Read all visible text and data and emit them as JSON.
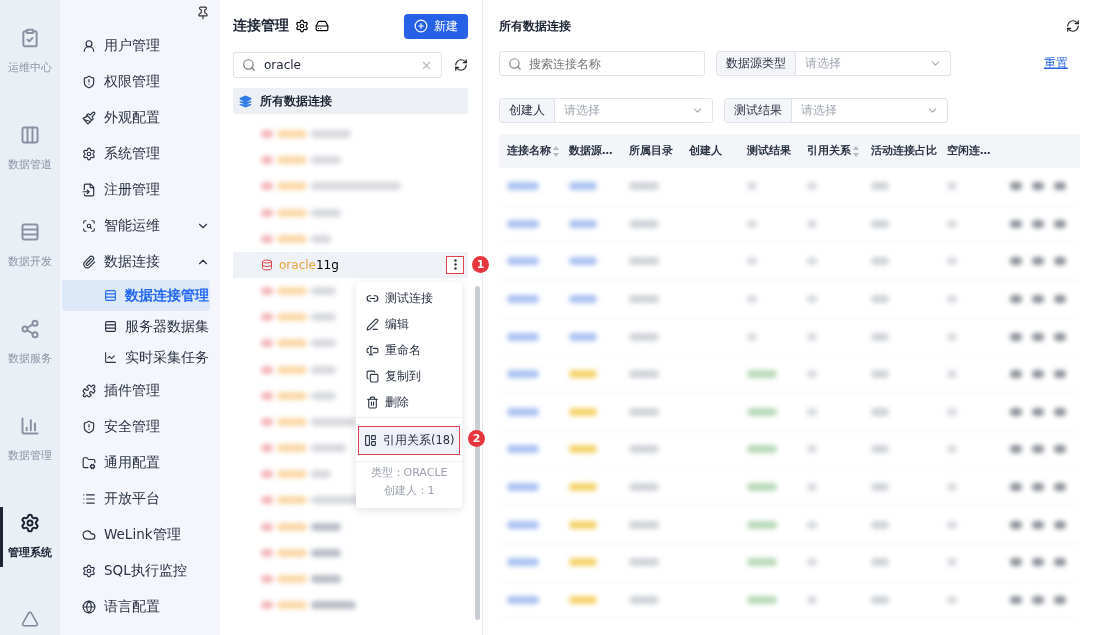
{
  "rail": {
    "items": [
      {
        "label": "运维中心",
        "selected": false
      },
      {
        "label": "数据管道",
        "selected": false
      },
      {
        "label": "数据开发",
        "selected": false
      },
      {
        "label": "数据服务",
        "selected": false
      },
      {
        "label": "数据管理",
        "selected": false
      },
      {
        "label": "管理系统",
        "selected": true
      }
    ]
  },
  "nav": {
    "items": [
      {
        "label": "用户管理"
      },
      {
        "label": "权限管理"
      },
      {
        "label": "外观配置"
      },
      {
        "label": "系统管理"
      },
      {
        "label": "注册管理"
      },
      {
        "label": "智能运维",
        "expanded": false
      },
      {
        "label": "数据连接",
        "expanded": true,
        "children": [
          {
            "label": "数据连接管理",
            "selected": true
          },
          {
            "label": "服务器数据集",
            "selected": false
          },
          {
            "label": "实时采集任务",
            "selected": false
          }
        ]
      },
      {
        "label": "插件管理"
      },
      {
        "label": "安全管理"
      },
      {
        "label": "通用配置"
      },
      {
        "label": "开放平台"
      },
      {
        "label": "WeLink管理"
      },
      {
        "label": "SQL执行监控"
      },
      {
        "label": "语言配置"
      }
    ]
  },
  "tree": {
    "title": "连接管理",
    "new_button": "新建",
    "search": {
      "value": "oracle"
    },
    "root": "所有数据连接",
    "active_item": {
      "match": "oracle",
      "rest": "11g",
      "marker": "1"
    },
    "menu": {
      "items": [
        {
          "label": "测试连接",
          "selected": false
        },
        {
          "label": "编辑",
          "selected": false
        },
        {
          "label": "重命名",
          "selected": false
        },
        {
          "label": "复制到",
          "selected": false
        },
        {
          "label": "删除",
          "selected": false
        },
        {
          "label": "引用关系(18)",
          "selected": true,
          "marker": "2"
        }
      ],
      "info": [
        "类型：ORACLE",
        "创建人：1"
      ]
    }
  },
  "main": {
    "title": "所有数据连接",
    "search": {
      "placeholder": "搜索连接名称"
    },
    "filters": [
      {
        "label": "数据源类型",
        "placeholder": "请选择"
      },
      {
        "label": "创建人",
        "placeholder": "请选择"
      },
      {
        "label": "测试结果",
        "placeholder": "请选择"
      }
    ],
    "reset": "重置",
    "table": {
      "columns": [
        {
          "label": "连接名称",
          "sortable": true
        },
        {
          "label": "数据源…",
          "sortable": false
        },
        {
          "label": "所属目录",
          "sortable": false
        },
        {
          "label": "创建人",
          "sortable": false
        },
        {
          "label": "测试结果",
          "sortable": false
        },
        {
          "label": "引用关系",
          "sortable": true
        },
        {
          "label": "活动连接占比",
          "sortable": false
        },
        {
          "label": "空闲连…",
          "sortable": false
        }
      ]
    }
  }
}
